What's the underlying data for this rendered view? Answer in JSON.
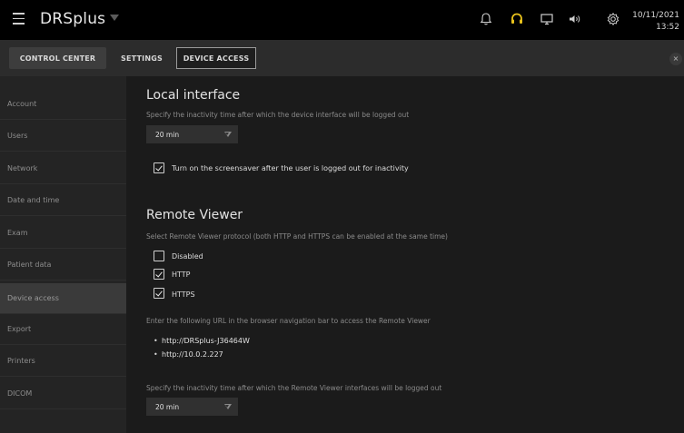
{
  "app": {
    "title": "DRSplus"
  },
  "clock": {
    "date": "10/11/2021",
    "time": "13:52"
  },
  "icons": {
    "menu": "hamburger-icon",
    "bell": "bell-icon",
    "headset": "headset-icon",
    "monitor": "monitor-icon",
    "speaker": "speaker-icon",
    "gear": "gear-icon",
    "close": "close-icon"
  },
  "colors": {
    "headset_active": "#e8c21c",
    "topbar": "#000000",
    "tabbar": "#2c2c2c"
  },
  "tabs": [
    {
      "label": "CONTROL CENTER"
    },
    {
      "label": "SETTINGS"
    },
    {
      "label": "DEVICE ACCESS",
      "selected": true
    }
  ],
  "close_label": "×",
  "sidebar": {
    "items": [
      {
        "label": "Account"
      },
      {
        "label": "Users"
      },
      {
        "label": "Network"
      },
      {
        "label": "Date and time"
      },
      {
        "label": "Exam"
      },
      {
        "label": "Patient data"
      },
      {
        "label": "Device access",
        "active": true
      },
      {
        "label": "Export"
      },
      {
        "label": "Printers"
      },
      {
        "label": "DICOM"
      }
    ]
  },
  "local": {
    "title": "Local interface",
    "desc": "Specify the inactivity time after which the device interface will be logged out",
    "timeout": "20 min",
    "screensaver_label": "Turn on the screensaver after the user is logged out for inactivity",
    "screensaver_checked": true
  },
  "remote": {
    "title": "Remote Viewer",
    "desc": "Select Remote Viewer protocol (both HTTP and HTTPS can be enabled at the same time)",
    "options": [
      {
        "label": "Disabled",
        "checked": false
      },
      {
        "label": "HTTP",
        "checked": true
      },
      {
        "label": "HTTPS",
        "checked": true
      }
    ],
    "url_desc": "Enter the following URL in the browser navigation bar to access the Remote Viewer",
    "urls": [
      "http://DRSplus-J36464W",
      "http://10.0.2.227"
    ],
    "timeout_desc": "Specify the inactivity time after which the Remote Viewer interfaces will be logged out",
    "timeout": "20 min"
  }
}
